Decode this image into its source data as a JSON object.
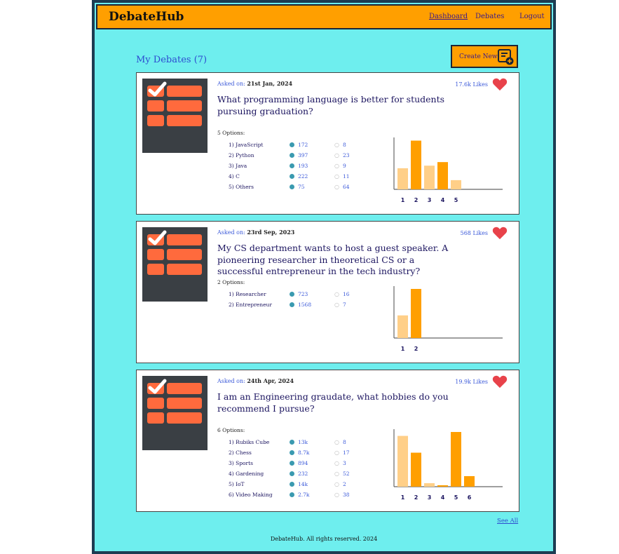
{
  "app": {
    "brand": "DebateHub"
  },
  "nav": {
    "dashboard": "Dashboard",
    "debates": "Debates",
    "logout": "Logout"
  },
  "main": {
    "title": "My Debates (7)",
    "create_label": "Create New",
    "see_all": "See All"
  },
  "footer": {
    "text": "DebateHub. All rights reserved. 2024"
  },
  "colors": {
    "accent": "#ff9f00",
    "background": "#6eeeee",
    "heart": "#e8424a",
    "bar": "#ff9f00",
    "bar_light": "#ffcf88"
  },
  "debates": [
    {
      "asked_label": "Asked on:",
      "asked_date": "21st Jan, 2024",
      "likes": "17.6k Likes",
      "question": "What programming language is better for students pursuing graduation?",
      "options_count": "5 Options:",
      "options": [
        {
          "label": "1) JavaScript",
          "votes": "172",
          "comments": "8"
        },
        {
          "label": "2) Python",
          "votes": "397",
          "comments": "23"
        },
        {
          "label": "3) Java",
          "votes": "193",
          "comments": "9"
        },
        {
          "label": "4) C",
          "votes": "222",
          "comments": "11"
        },
        {
          "label": "5) Others",
          "votes": "75",
          "comments": "64"
        }
      ],
      "chart_data": {
        "type": "bar",
        "categories": [
          "1",
          "2",
          "3",
          "4",
          "5"
        ],
        "values": [
          172,
          397,
          193,
          222,
          75
        ],
        "ylim": [
          0,
          400
        ]
      }
    },
    {
      "asked_label": "Asked on:",
      "asked_date": "23rd Sep, 2023",
      "likes": "568 Likes",
      "question": "My CS department wants to host a guest speaker. A pioneering researcher in theoretical CS or a successful entrepreneur in the tech industry?",
      "options_count": "2 Options:",
      "options": [
        {
          "label": "1) Researcher",
          "votes": "723",
          "comments": "16"
        },
        {
          "label": "2) Entrepreneur",
          "votes": "1568",
          "comments": "7"
        }
      ],
      "chart_data": {
        "type": "bar",
        "categories": [
          "1",
          "2"
        ],
        "values": [
          723,
          1568
        ],
        "ylim": [
          0,
          1568
        ]
      }
    },
    {
      "asked_label": "Asked on:",
      "asked_date": "24th Apr, 2024",
      "likes": "19.9k Likes",
      "question": "I am an Engineering graudate, what hobbies do you recommend I pursue?",
      "options_count": "6 Options:",
      "options": [
        {
          "label": "1) Rubiks Cube",
          "votes": "13k",
          "comments": "8"
        },
        {
          "label": "2) Chess",
          "votes": "8.7k",
          "comments": "17"
        },
        {
          "label": "3) Sports",
          "votes": "894",
          "comments": "3"
        },
        {
          "label": "4) Gardening",
          "votes": "232",
          "comments": "52"
        },
        {
          "label": "5) IoT",
          "votes": "14k",
          "comments": "2"
        },
        {
          "label": "6) Video Making",
          "votes": "2.7k",
          "comments": "38"
        }
      ],
      "chart_data": {
        "type": "bar",
        "categories": [
          "1",
          "2",
          "3",
          "4",
          "5",
          "6"
        ],
        "values": [
          13000,
          8700,
          894,
          232,
          14000,
          2700
        ],
        "ylim": [
          0,
          14000
        ]
      }
    }
  ]
}
